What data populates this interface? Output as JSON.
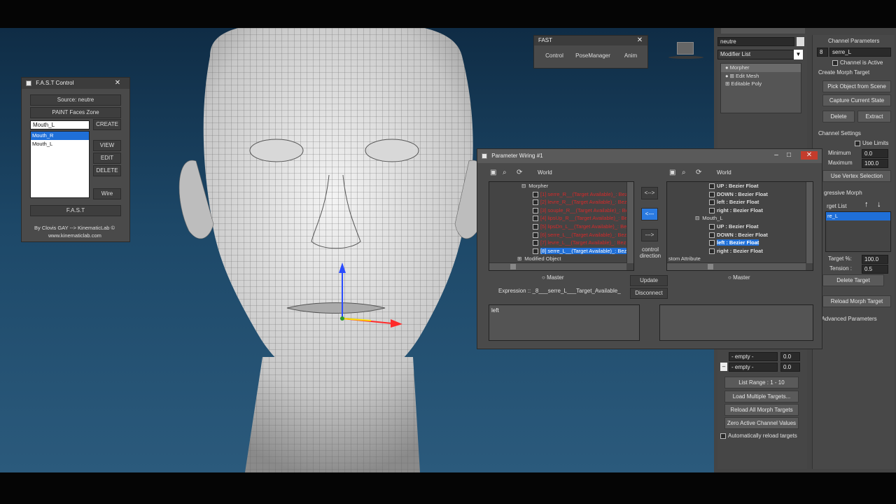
{
  "fast_control": {
    "title": "F.A.S.T Control",
    "source": "Source: neutre",
    "paint": "PAINT Faces Zone",
    "input_value": "Mouth_L",
    "create": "CREATE",
    "list": [
      "Mouth_R",
      "Mouth_L"
    ],
    "view": "VIEW",
    "edit": "EDIT",
    "delete": "DELETE",
    "wire": "Wire",
    "fast": "F.A.S.T",
    "credit1": "By Clovis GAY --> KinematicLab ©",
    "credit2": "www.kinematiclab.com"
  },
  "fast_toolbar": {
    "title": "FAST",
    "control": "Control",
    "posemanager": "PoseManager",
    "anim": "Anim"
  },
  "wiring": {
    "title": "Parameter Wiring #1",
    "world_left": "World",
    "world_right": "World",
    "left_tree": [
      {
        "text": "Morpher",
        "cls": ""
      },
      {
        "text": "[1] serre_R__(Target Available)_: Bez",
        "cls": "red"
      },
      {
        "text": "[2] levre_R__(Target Available)_: Bez",
        "cls": "red"
      },
      {
        "text": "[3] souple_R__(Target Available)_: Bez",
        "cls": "red"
      },
      {
        "text": "[4] lipsUp_R__(Target Available)_: Bez",
        "cls": "red"
      },
      {
        "text": "[5] lipsDn_L__(Target Available)_: Bez",
        "cls": "red"
      },
      {
        "text": "[6] serre_L__(Target Available)_: Bez",
        "cls": "red"
      },
      {
        "text": "[7] levre_L__(Target Available)_: Bez",
        "cls": "red"
      },
      {
        "text": "[8] serre_L__(Target Available)_: Bez",
        "cls": "sel"
      },
      {
        "text": "Modified Object",
        "cls": ""
      }
    ],
    "right_tree": [
      {
        "text": "UP : Bezier Float",
        "cls": ""
      },
      {
        "text": "DOWN : Bezier Float",
        "cls": ""
      },
      {
        "text": "left : Bezier Float",
        "cls": ""
      },
      {
        "text": "right : Bezier Float",
        "cls": ""
      },
      {
        "text": "Mouth_L",
        "cls": "grp"
      },
      {
        "text": "UP : Bezier Float",
        "cls": ""
      },
      {
        "text": "DOWN : Bezier Float",
        "cls": ""
      },
      {
        "text": "left : Bezier Float",
        "cls": "sel"
      },
      {
        "text": "right : Bezier Float",
        "cls": ""
      }
    ],
    "right_tree_footer": "stom Attribute",
    "arrow_both": "<-->",
    "arrow_left": "<---",
    "arrow_right": "--->",
    "control_direction": "control direction",
    "master_left": "Master",
    "master_right": "Master",
    "update": "Update",
    "disconnect": "Disconnect",
    "expression": "Expression :: _8___serre_L___Target_Available_",
    "expr_left": "left",
    "expr_right": ""
  },
  "stack": {
    "object_name": "neutre",
    "modifier_list": "Modifier List",
    "items": [
      "Morpher",
      "Edit Mesh",
      "Editable Poly"
    ],
    "empty1": "- empty -",
    "empty1_val": "0.0",
    "empty2": "- empty -",
    "empty2_val": "0.0",
    "list_range_label": "List Range :",
    "list_range_value": "1 - 10",
    "load_multiple": "Load Multiple Targets...",
    "reload_all": "Reload All Morph Targets",
    "zero_active": "Zero Active Channel Values",
    "auto_reload": "Automatically reload targets"
  },
  "channel": {
    "header": "Channel Parameters",
    "num": "8",
    "name": "serre_L",
    "active": "Channel is Active",
    "create_header": "Create Morph Target",
    "pick": "Pick Object from Scene",
    "capture": "Capture Current State",
    "delete": "Delete",
    "extract": "Extract",
    "settings": "Channel Settings",
    "use_limits": "Use Limits",
    "minimum": "Minimum",
    "minimum_val": "0.0",
    "maximum": "Maximum",
    "maximum_val": "100.0",
    "use_vertex": "Use Vertex Selection",
    "progressive": "gressive Morph",
    "target_list": "rget List",
    "target_item": "re_L",
    "target_pct": "Target %:",
    "target_pct_val": "100.0",
    "tension": "Tension :",
    "tension_val": "0.5",
    "delete_target": "Delete Target",
    "reload": "Reload Morph Target",
    "advanced": "Advanced Parameters"
  }
}
